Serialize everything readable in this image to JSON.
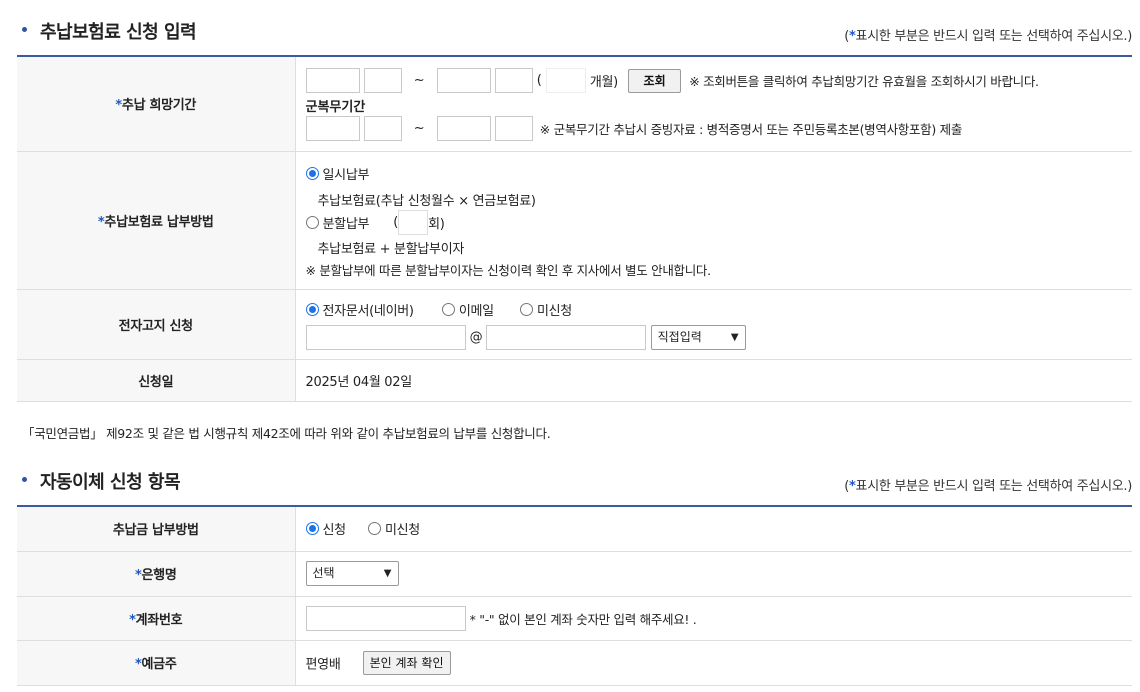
{
  "section1": {
    "title": "추납보험료 신청 입력",
    "note_prefix": "(",
    "note_star": "*",
    "note_text": "표시한 부분은 반드시 입력 또는 선택하여 주십시오.)"
  },
  "period": {
    "label": "추납 희망기간",
    "tilde": "~",
    "months_open": "(",
    "months_unit": "개월)",
    "lookup_button": "조회",
    "lookup_note": "※ 조회버튼을 클릭하여 추납희망기간 유효월을 조회하시기 바랍니다.",
    "military_label": "군복무기간",
    "military_note": "※ 군복무기간 추납시 증빙자료 : 병적증명서 또는 주민등록초본(병역사항포함) 제출"
  },
  "payment_method": {
    "label": "추납보험료 납부방법",
    "lump_sum": "일시납부",
    "lump_sum_desc": "추납보험료(추납 신청월수 × 연금보험료)",
    "installment": "분할납부",
    "installment_open": "(",
    "installment_unit": "회)",
    "installment_desc": "추납보험료 + 분할납부이자",
    "notice": "※ 분할납부에 따른 분할납부이자는 신청이력 확인 후 지사에서 별도 안내합니다."
  },
  "e_notice": {
    "label": "전자고지 신청",
    "options": [
      "전자문서(네이버)",
      "이메일",
      "미신청"
    ],
    "at": "@",
    "domain_select": "직접입력"
  },
  "apply_date": {
    "label": "신청일",
    "value": "2025년 04월 02일"
  },
  "legal_text": "「국민연금법」 제92조 및 같은 법 시행규칙 제42조에 따라 위와 같이 추납보험료의 납부를 신청합니다.",
  "section2": {
    "title": "자동이체 신청 항목",
    "note_prefix": "(",
    "note_star": "*",
    "note_text": "표시한 부분은 반드시 입력 또는 선택하여 주십시오.)"
  },
  "auto_transfer": {
    "method_label": "추납금 납부방법",
    "method_options": [
      "신청",
      "미신청"
    ],
    "bank_label": "은행명",
    "bank_select": "선택",
    "account_label": "계좌번호",
    "account_note": "* \"-\" 없이 본인 계좌 숫자만 입력 해주세요! .",
    "holder_label": "예금주",
    "holder_value": "편영배",
    "verify_button": "본인 계좌 확인"
  },
  "star": "*",
  "colors": {
    "accent": "#1f57c3",
    "table_border": "#3b5aa0",
    "header_bg": "#f7f7f7"
  }
}
